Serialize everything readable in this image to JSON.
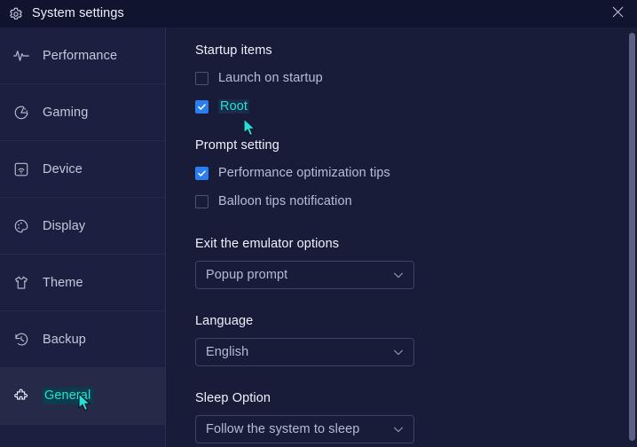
{
  "window": {
    "title": "System settings",
    "gear_icon": "gear-icon",
    "close_icon": "close-icon",
    "accent_color": "#25e0d4",
    "checkbox_color": "#2b7ef0",
    "background_color": "#181c38",
    "titlebar_color": "#11142e",
    "sidebar_color": "#1c2040"
  },
  "sidebar": {
    "items": [
      {
        "label": "Performance",
        "icon": "pulse-icon",
        "active": false
      },
      {
        "label": "Gaming",
        "icon": "gamepad-icon",
        "active": false
      },
      {
        "label": "Device",
        "icon": "device-icon",
        "active": false
      },
      {
        "label": "Display",
        "icon": "palette-icon",
        "active": false
      },
      {
        "label": "Theme",
        "icon": "shirt-icon",
        "active": false
      },
      {
        "label": "Backup",
        "icon": "history-icon",
        "active": false
      },
      {
        "label": "General",
        "icon": "puzzle-icon",
        "active": true
      }
    ]
  },
  "main": {
    "startup": {
      "title": "Startup items",
      "options": [
        {
          "label": "Launch on startup",
          "checked": false,
          "highlighted": false
        },
        {
          "label": "Root",
          "checked": true,
          "highlighted": true
        }
      ]
    },
    "prompt": {
      "title": "Prompt setting",
      "options": [
        {
          "label": "Performance optimization tips",
          "checked": true,
          "highlighted": false
        },
        {
          "label": "Balloon tips notification",
          "checked": false,
          "highlighted": false
        }
      ]
    },
    "exit": {
      "title": "Exit the emulator options",
      "value": "Popup prompt",
      "chevron_icon": "chevron-down-icon"
    },
    "language": {
      "title": "Language",
      "value": "English",
      "chevron_icon": "chevron-down-icon"
    },
    "sleep": {
      "title": "Sleep Option",
      "value": "Follow the system to sleep",
      "chevron_icon": "chevron-down-icon"
    }
  },
  "scrollbar": {
    "name": "vertical-scrollbar"
  }
}
